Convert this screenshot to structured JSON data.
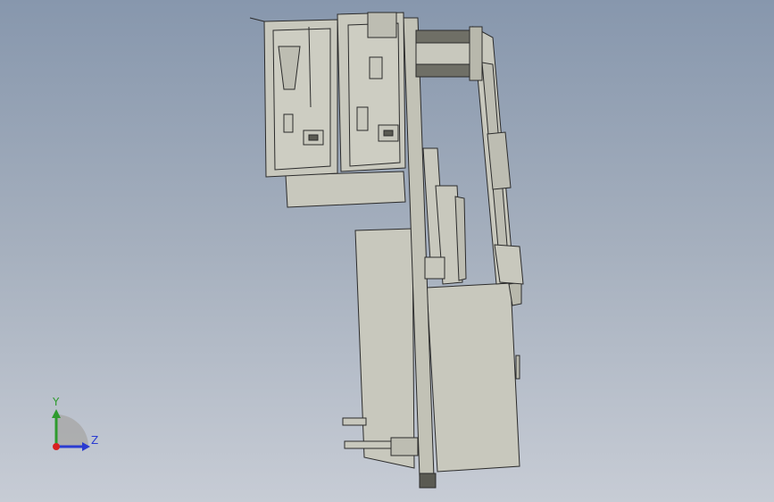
{
  "scene": {
    "background_top": "#8797ad",
    "background_bottom": "#c7ccd5",
    "part_fill": "#c8c8bd",
    "part_fill_dark": "#b8b8ac",
    "edge_color": "#2b2b2b",
    "motor_color": "#6f6f66"
  },
  "triad": {
    "y_label": "Y",
    "z_label": "Z",
    "y_color": "#2e9b2e",
    "z_color": "#2a3bd1",
    "origin_color": "#d82020"
  }
}
